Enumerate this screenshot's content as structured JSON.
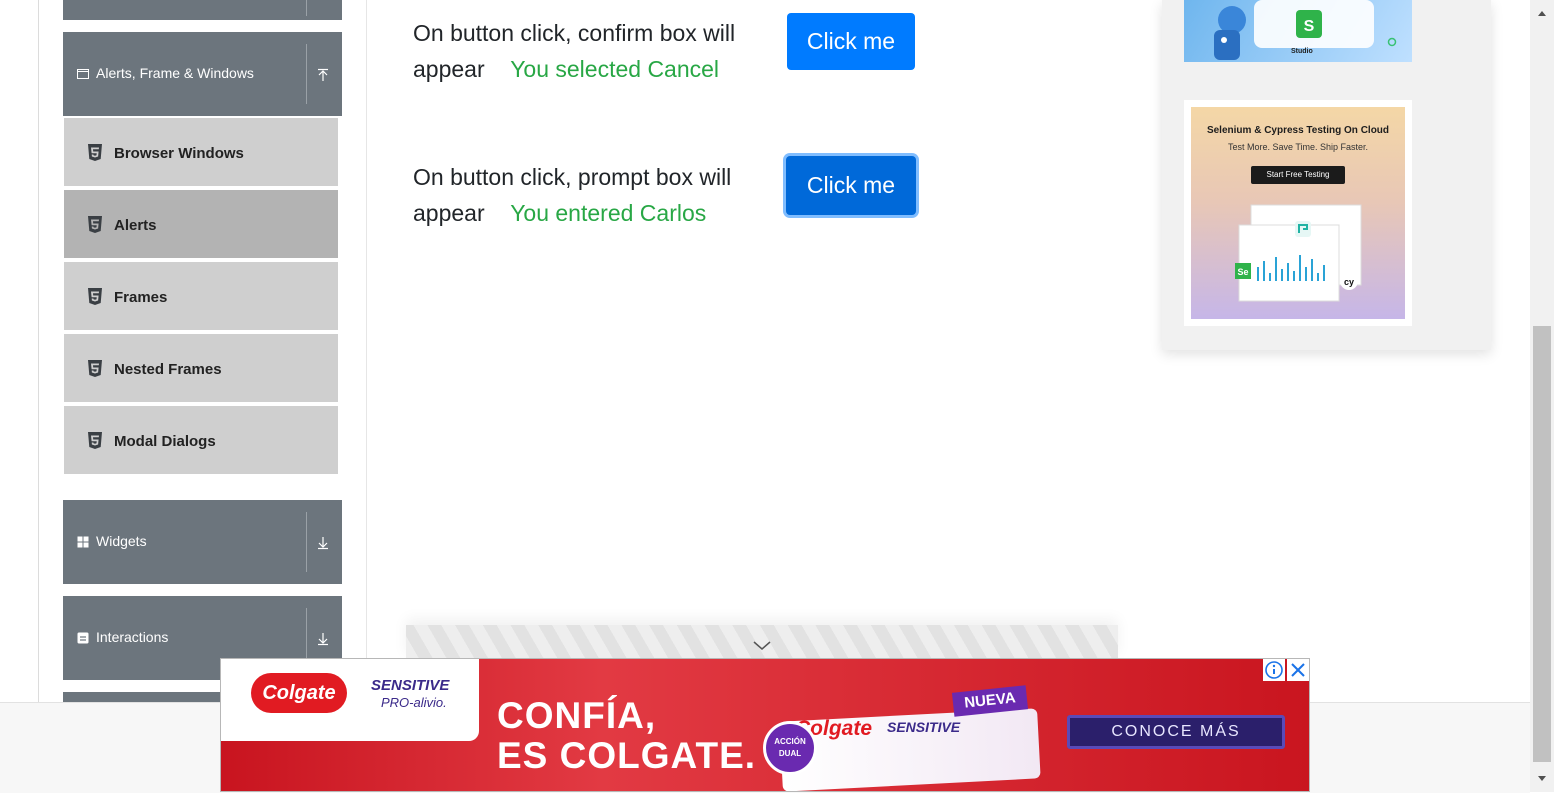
{
  "sidebar": {
    "group_alerts": {
      "label": "Alerts, Frame & Windows"
    },
    "items": [
      {
        "label": "Browser Windows"
      },
      {
        "label": "Alerts"
      },
      {
        "label": "Frames"
      },
      {
        "label": "Nested Frames"
      },
      {
        "label": "Modal Dialogs"
      }
    ],
    "group_widgets": {
      "label": "Widgets"
    },
    "group_interactions": {
      "label": "Interactions"
    }
  },
  "main": {
    "confirm": {
      "description": "On button click, confirm box will appear",
      "result": "You selected Cancel",
      "button_label": "Click me"
    },
    "prompt": {
      "description": "On button click, prompt box will appear",
      "result": "You entered Carlos",
      "button_label": "Click me"
    }
  },
  "ads": {
    "top_banner_label": "Studio",
    "lambdatest": {
      "headline": "Selenium & Cypress Testing On Cloud",
      "sub": "Test More. Save Time. Ship Faster.",
      "cta": "Start Free Testing"
    },
    "colgate": {
      "brand": "Colgate",
      "product": "SENSITIVE",
      "product_sub": "PRO-alivio.",
      "slogan_line1": "CONFÍA,",
      "slogan_line2": "ES COLGATE.",
      "badge": "NUEVA",
      "accion": "ACCIÓN DUAL",
      "cta": "CONOCE MÁS"
    }
  },
  "colors": {
    "primary": "#007bff",
    "success": "#28a745",
    "sidebar_header": "#6c757d",
    "sidebar_item": "#cfcfcf"
  }
}
